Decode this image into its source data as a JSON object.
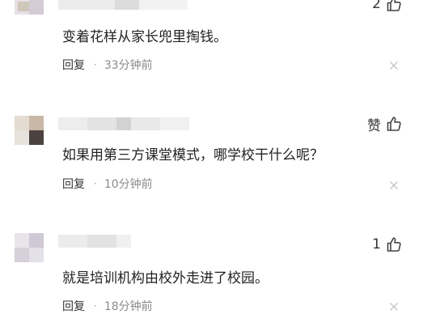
{
  "comments": [
    {
      "like_label": "2",
      "text": "变着花样从家长兜里掏钱。",
      "reply_label": "回复",
      "separator": "·",
      "time": "33分钟前"
    },
    {
      "like_label": "赞",
      "text": "如果用第三方课堂模式，哪学校干什么呢？",
      "reply_label": "回复",
      "separator": "·",
      "time": "10分钟前"
    },
    {
      "like_label": "1",
      "text": "就是培训机构由校外走进了校园。",
      "reply_label": "回复",
      "separator": "·",
      "time": "18分钟前"
    }
  ],
  "icons": {
    "like": "thumbs-up-icon",
    "close": "close-x-icon"
  },
  "colors": {
    "text": "#222222",
    "meta": "#8a8a8a",
    "icon": "#444444"
  }
}
